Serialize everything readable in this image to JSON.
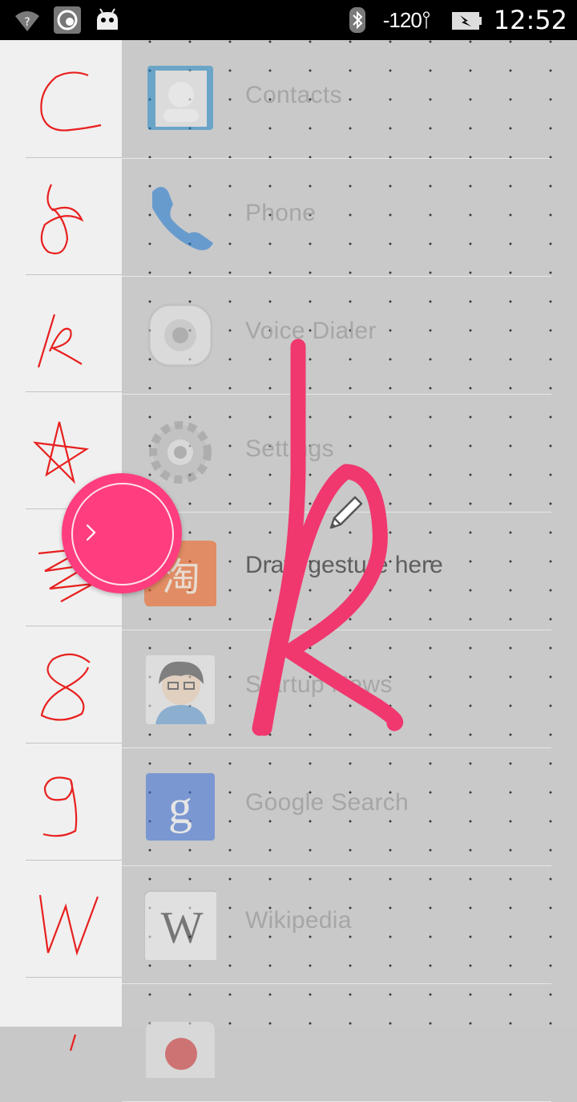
{
  "status_bar": {
    "signal_text": "-120",
    "time": "12:52",
    "icons": [
      "wifi-question-icon",
      "cyanogen-icon",
      "android-icon",
      "bluetooth-icon",
      "signal-icon",
      "battery-charging-icon"
    ]
  },
  "apps": [
    {
      "label": "Contacts",
      "icon": "contacts-app-icon"
    },
    {
      "label": "Phone",
      "icon": "phone-app-icon"
    },
    {
      "label": "Voice Dialer",
      "icon": "voice-dialer-app-icon"
    },
    {
      "label": "Settings",
      "icon": "settings-app-icon"
    },
    {
      "label": "",
      "icon": "taobao-app-icon"
    },
    {
      "label": "Startup News",
      "icon": "startup-news-app-icon"
    },
    {
      "label": "Google Search",
      "icon": "google-search-app-icon"
    },
    {
      "label": "Wikipedia",
      "icon": "wikipedia-app-icon"
    },
    {
      "label": "",
      "icon": "app-icon"
    }
  ],
  "gestures": [
    {
      "name": "gesture-c"
    },
    {
      "name": "gesture-d"
    },
    {
      "name": "gesture-k"
    },
    {
      "name": "gesture-star"
    },
    {
      "name": "gesture-zigzag"
    },
    {
      "name": "gesture-8"
    },
    {
      "name": "gesture-9"
    },
    {
      "name": "gesture-w"
    },
    {
      "name": "gesture-l"
    }
  ],
  "hint": "Draw gesture here",
  "colors": {
    "accent": "#ff3d7f",
    "stroke": "#f0386e",
    "gesture_red": "#e8201f"
  }
}
